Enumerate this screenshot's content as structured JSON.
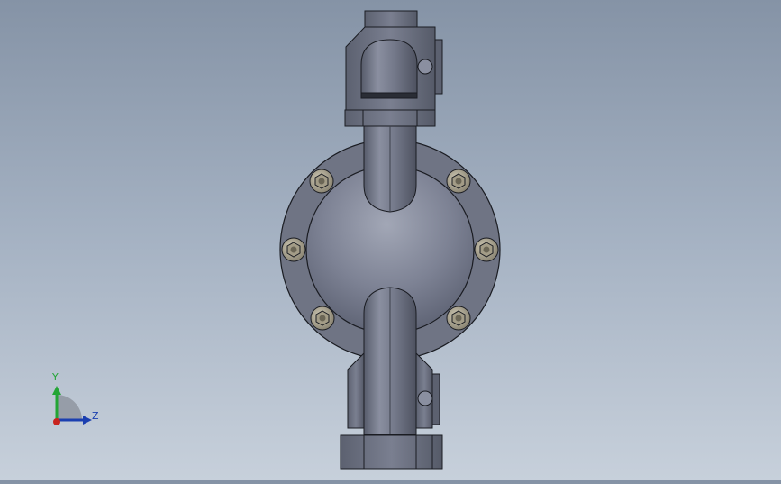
{
  "view": {
    "background_top": "#8593a6",
    "background_bottom": "#c7d0db",
    "model": "diaphragm-pump"
  },
  "triad": {
    "y_label": "Y",
    "z_label": "Z",
    "y_color": "#23a535",
    "z_color": "#1b3fb0",
    "x_color": "#c8241f"
  },
  "model_colors": {
    "body": "#6c7282",
    "body_dark": "#4b505e",
    "edge": "#1a1c22",
    "bolt": "#b7b09c"
  }
}
